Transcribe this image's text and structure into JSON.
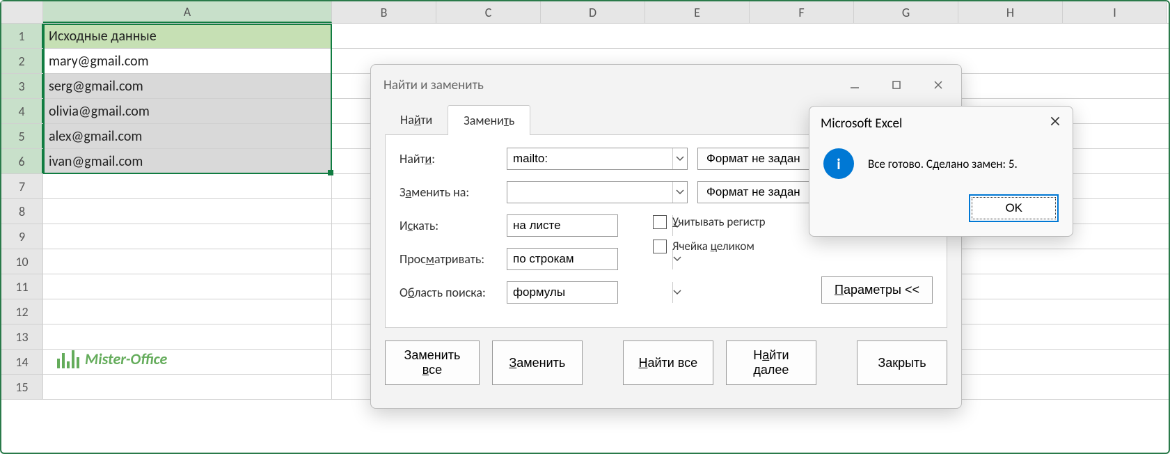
{
  "spreadsheet": {
    "columns": [
      "A",
      "B",
      "C",
      "D",
      "E",
      "F",
      "G",
      "H",
      "I"
    ],
    "rows": [
      {
        "n": "1",
        "cells": [
          "Исходные данные"
        ],
        "header": true
      },
      {
        "n": "2",
        "cells": [
          "mary@gmail.com"
        ],
        "active": true
      },
      {
        "n": "3",
        "cells": [
          "serg@gmail.com"
        ]
      },
      {
        "n": "4",
        "cells": [
          "olivia@gmail.com"
        ]
      },
      {
        "n": "5",
        "cells": [
          "alex@gmail.com"
        ]
      },
      {
        "n": "6",
        "cells": [
          "ivan@gmail.com"
        ]
      },
      {
        "n": "7",
        "cells": [
          ""
        ]
      },
      {
        "n": "8",
        "cells": [
          ""
        ]
      },
      {
        "n": "9",
        "cells": [
          ""
        ]
      },
      {
        "n": "10",
        "cells": [
          ""
        ]
      },
      {
        "n": "11",
        "cells": [
          ""
        ]
      },
      {
        "n": "12",
        "cells": [
          ""
        ]
      },
      {
        "n": "13",
        "cells": [
          ""
        ]
      },
      {
        "n": "14",
        "cells": [
          ""
        ]
      },
      {
        "n": "15",
        "cells": [
          ""
        ]
      }
    ],
    "selected_rows": [
      "1",
      "2",
      "3",
      "4",
      "5",
      "6"
    ]
  },
  "watermark": "Mister-Office",
  "find_replace": {
    "title": "Найти и заменить",
    "tabs": {
      "find": "Найти",
      "replace": "Заменить"
    },
    "labels": {
      "find": "Найти:",
      "replace": "Заменить на:",
      "search": "Искать:",
      "look": "Просматривать:",
      "scope": "Область поиска:"
    },
    "values": {
      "find": "mailto:",
      "replace": "",
      "search": "на листе",
      "look": "по строкам",
      "scope": "формулы"
    },
    "format_btn": "Формат не задан",
    "checkboxes": {
      "case": "Учитывать регистр",
      "whole": "Ячейка целиком"
    },
    "params": "Параметры <<",
    "buttons": {
      "replace_all": "Заменить все",
      "replace": "Заменить",
      "find_all": "Найти все",
      "find_next": "Найти далее",
      "close": "Закрыть"
    }
  },
  "msgbox": {
    "title": "Microsoft Excel",
    "icon": "i",
    "text": "Все готово. Сделано замен: 5.",
    "ok": "OK"
  }
}
